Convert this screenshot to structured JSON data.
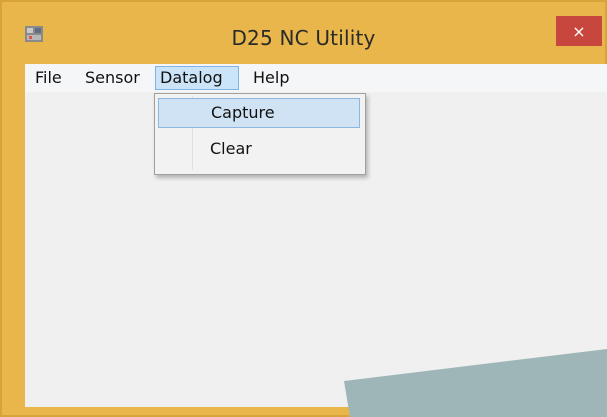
{
  "window": {
    "title": "D25 NC Utility",
    "close_glyph": "×"
  },
  "menubar": {
    "items": [
      {
        "label": "File"
      },
      {
        "label": "Sensor"
      },
      {
        "label": "Datalog"
      },
      {
        "label": "Help"
      }
    ]
  },
  "dropdown": {
    "items": [
      {
        "label": "Capture",
        "highlighted": true
      },
      {
        "label": "Clear",
        "highlighted": false
      }
    ]
  },
  "colors": {
    "frame": "#e8b64a",
    "close": "#c7463e",
    "menu_highlight": "#cce4f7",
    "menu_highlight_border": "#7fb4e4",
    "client": "#f0f0f0"
  },
  "icons": {
    "app": "app-icon",
    "close": "close-icon"
  }
}
